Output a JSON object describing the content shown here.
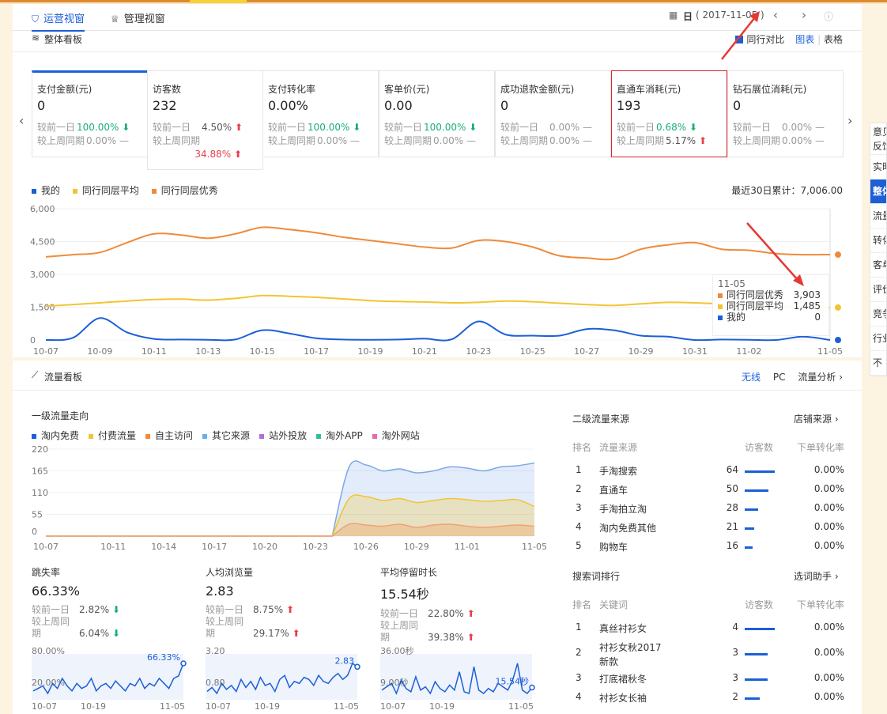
{
  "tabs": [
    {
      "label": "运营视窗"
    },
    {
      "label": "管理视窗"
    }
  ],
  "date": {
    "prefix": "日",
    "value": "( 2017-11-05 )"
  },
  "overview": {
    "title": "整体看板",
    "peer_compare": "同行对比",
    "chart_link": "图表",
    "table_link": "表格",
    "metrics": [
      {
        "label": "支付金额(元)",
        "value": "0",
        "c1_label": "较前一日",
        "c1_val": "100.00%",
        "c1_dir": "down",
        "c2_label": "较上周同期",
        "c2_val": "0.00%",
        "c2_dir": "flat"
      },
      {
        "label": "访客数",
        "value": "232",
        "c1_label": "较前一日",
        "c1_val": "4.50%",
        "c1_dir": "up",
        "c2_label": "较上周同期",
        "c2_val": "34.88%",
        "c2_dir": "up"
      },
      {
        "label": "支付转化率",
        "value": "0.00%",
        "c1_label": "较前一日",
        "c1_val": "100.00%",
        "c1_dir": "down",
        "c2_label": "较上周同期",
        "c2_val": "0.00%",
        "c2_dir": "flat"
      },
      {
        "label": "客单价(元)",
        "value": "0.00",
        "c1_label": "较前一日",
        "c1_val": "100.00%",
        "c1_dir": "down",
        "c2_label": "较上周同期",
        "c2_val": "0.00%",
        "c2_dir": "flat"
      },
      {
        "label": "成功退款金额(元)",
        "value": "0",
        "c1_label": "较前一日",
        "c1_val": "0.00%",
        "c1_dir": "flat",
        "c2_label": "较上周同期",
        "c2_val": "0.00%",
        "c2_dir": "flat"
      },
      {
        "label": "直通车消耗(元)",
        "value": "193",
        "c1_label": "较前一日",
        "c1_val": "0.68%",
        "c1_dir": "down",
        "c2_label": "较上周同期",
        "c2_val": "5.17%",
        "c2_dir": "up"
      },
      {
        "label": "钻石展位消耗(元)",
        "value": "0",
        "c1_label": "较前一日",
        "c1_val": "0.00%",
        "c1_dir": "flat",
        "c2_label": "较上周同期",
        "c2_val": "0.00%",
        "c2_dir": "flat"
      }
    ],
    "cumulative": "最近30日累计：7,006.00",
    "tooltip": {
      "date": "11-05",
      "rows": [
        {
          "name": "同行同层优秀",
          "value": "3,903"
        },
        {
          "name": "同行同层平均",
          "value": "1,485"
        },
        {
          "name": "我的",
          "value": "0"
        }
      ]
    }
  },
  "chart_data": [
    {
      "type": "line",
      "title": "",
      "x": [
        "10-07",
        "10-08",
        "10-09",
        "10-10",
        "10-11",
        "10-12",
        "10-13",
        "10-14",
        "10-15",
        "10-16",
        "10-17",
        "10-18",
        "10-19",
        "10-20",
        "10-21",
        "10-22",
        "10-23",
        "10-24",
        "10-25",
        "10-26",
        "10-27",
        "10-28",
        "10-29",
        "10-30",
        "10-31",
        "11-01",
        "11-02",
        "11-03",
        "11-04",
        "11-05"
      ],
      "x_ticks": [
        "10-07",
        "10-09",
        "10-11",
        "10-13",
        "10-15",
        "10-17",
        "10-19",
        "10-21",
        "10-23",
        "10-25",
        "10-27",
        "10-29",
        "10-31",
        "11-02",
        "11-05"
      ],
      "y_ticks": [
        "6,000",
        "4,500",
        "3,000",
        "1,500",
        "0"
      ],
      "ylim": [
        0,
        6000
      ],
      "colors": {
        "我的": "#1c5fd6",
        "同行同层平均": "#f2c530",
        "同行同层优秀": "#f08a3a"
      },
      "series": [
        {
          "name": "我的",
          "values": [
            0,
            100,
            1000,
            350,
            50,
            20,
            10,
            20,
            450,
            300,
            80,
            20,
            10,
            20,
            60,
            30,
            850,
            250,
            200,
            200,
            500,
            450,
            200,
            150,
            0,
            20,
            10,
            0,
            150,
            0
          ]
        },
        {
          "name": "同行同层平均",
          "values": [
            1550,
            1620,
            1700,
            1780,
            1850,
            1870,
            1820,
            1900,
            2030,
            2000,
            1950,
            1880,
            1800,
            1760,
            1740,
            1700,
            1720,
            1780,
            1750,
            1680,
            1620,
            1580,
            1650,
            1720,
            1700,
            1650,
            1600,
            1520,
            1500,
            1485
          ]
        },
        {
          "name": "同行同层优秀",
          "values": [
            3800,
            3900,
            4000,
            4450,
            4850,
            4800,
            4650,
            4850,
            5150,
            5050,
            4900,
            4700,
            4550,
            4400,
            4250,
            4200,
            4550,
            4500,
            4250,
            3850,
            3750,
            3700,
            4150,
            4350,
            4450,
            4150,
            4100,
            3950,
            3900,
            3903
          ]
        }
      ]
    },
    {
      "type": "area",
      "title": "一级流量走向",
      "x": [
        "10-07",
        "10-08",
        "10-09",
        "10-10",
        "10-11",
        "10-12",
        "10-13",
        "10-14",
        "10-15",
        "10-16",
        "10-17",
        "10-18",
        "10-19",
        "10-20",
        "10-21",
        "10-22",
        "10-23",
        "10-24",
        "10-25",
        "10-26",
        "10-27",
        "10-28",
        "10-29",
        "10-30",
        "10-31",
        "11-01",
        "11-02",
        "11-03",
        "11-04",
        "11-05"
      ],
      "x_ticks": [
        "10-07",
        "10-11",
        "10-14",
        "10-17",
        "10-20",
        "10-23",
        "10-26",
        "10-29",
        "11-01",
        "11-05"
      ],
      "y_ticks": [
        "220",
        "165",
        "110",
        "55",
        "0"
      ],
      "ylim": [
        0,
        220
      ],
      "legend": [
        {
          "name": "淘内免费",
          "color": "#1c5fd6"
        },
        {
          "name": "付费流量",
          "color": "#f2c530"
        },
        {
          "name": "自主访问",
          "color": "#f08a3a"
        },
        {
          "name": "其它来源",
          "color": "#6aaee6"
        },
        {
          "name": "站外投放",
          "color": "#b36be0"
        },
        {
          "name": "淘外APP",
          "color": "#2bbf9c"
        },
        {
          "name": "淘外网站",
          "color": "#e66aa8"
        }
      ],
      "series": [
        {
          "name": "淘内免费",
          "values": [
            0,
            0,
            0,
            0,
            0,
            0,
            0,
            0,
            0,
            0,
            0,
            0,
            0,
            0,
            0,
            0,
            0,
            0,
            175,
            180,
            165,
            170,
            160,
            165,
            175,
            172,
            165,
            175,
            178,
            185
          ]
        },
        {
          "name": "付费流量",
          "values": [
            0,
            0,
            0,
            0,
            0,
            0,
            0,
            0,
            0,
            0,
            0,
            0,
            0,
            0,
            0,
            0,
            0,
            0,
            95,
            100,
            90,
            95,
            85,
            90,
            95,
            92,
            88,
            90,
            92,
            75
          ]
        },
        {
          "name": "自主访问",
          "values": [
            0,
            0,
            0,
            0,
            0,
            0,
            0,
            0,
            0,
            0,
            0,
            0,
            0,
            0,
            0,
            0,
            0,
            0,
            30,
            28,
            25,
            30,
            22,
            28,
            30,
            25,
            22,
            25,
            28,
            25
          ]
        }
      ]
    }
  ],
  "flow": {
    "title": "流量看板",
    "wireless": "无线",
    "pc": "PC",
    "analysis": "流量分析",
    "kpis": [
      {
        "title": "跳失率",
        "value": "66.33%",
        "c1_label": "较前一日",
        "c1_val": "2.82%",
        "c1_dir": "down",
        "c2_label1": "较上周同",
        "c2_label2": "期",
        "c2_val": "6.04%",
        "c2_dir": "down",
        "spark_top": "80.00%",
        "spark_bottom": "20.00%",
        "spark_end": "66.33%",
        "ticks": [
          "10-07",
          "10-19",
          "11-05"
        ],
        "spark": [
          55,
          56,
          57,
          54,
          58,
          56,
          60,
          57,
          55,
          58,
          56,
          57,
          60,
          55,
          57,
          58,
          56,
          59,
          57,
          55,
          58,
          57,
          60,
          56,
          58,
          57,
          60,
          58,
          56,
          60,
          61,
          66
        ]
      },
      {
        "title": "人均浏览量",
        "value": "2.83",
        "c1_label": "较前一日",
        "c1_val": "8.75%",
        "c1_dir": "up",
        "c2_label1": "较上周同",
        "c2_label2": "期",
        "c2_val": "29.17%",
        "c2_dir": "up",
        "spark_top": "3.20",
        "spark_bottom": "0.80",
        "spark_end": "2.83",
        "ticks": [
          "10-07",
          "10-19",
          "11-05"
        ],
        "spark": [
          1.6,
          1.8,
          1.5,
          2.0,
          1.7,
          1.9,
          1.6,
          2.2,
          1.8,
          2.1,
          1.7,
          2.3,
          1.9,
          2.0,
          1.6,
          2.2,
          2.4,
          1.8,
          2.1,
          2.0,
          2.3,
          2.2,
          1.9,
          2.4,
          2.1,
          2.0,
          2.3,
          2.5,
          2.2,
          2.4,
          3.0,
          2.83
        ]
      },
      {
        "title": "平均停留时长",
        "value": "15.54秒",
        "c1_label": "较前一日",
        "c1_val": "22.80%",
        "c1_dir": "up",
        "c2_label1": "较上周同",
        "c2_label2": "期",
        "c2_val": "39.38%",
        "c2_dir": "up",
        "spark_top": "36.00秒",
        "spark_bottom": "9.00秒",
        "spark_end": "15.54秒",
        "ticks": [
          "10-07",
          "10-19",
          "11-05"
        ],
        "spark": [
          14,
          16,
          18,
          12,
          20,
          15,
          13,
          22,
          14,
          16,
          12,
          19,
          15,
          13,
          17,
          14,
          25,
          13,
          12,
          28,
          14,
          12,
          15,
          13,
          18,
          16,
          14,
          20,
          30,
          14,
          12,
          15.54
        ]
      }
    ],
    "level2": {
      "title": "二级流量来源",
      "link": "店铺来源",
      "headers": [
        "排名",
        "流量来源",
        "访客数",
        "下单转化率"
      ],
      "rows": [
        {
          "rank": "1",
          "name": "手淘搜索",
          "visitors": "64",
          "bar": 64,
          "rate": "0.00%"
        },
        {
          "rank": "2",
          "name": "直通车",
          "visitors": "50",
          "bar": 50,
          "rate": "0.00%"
        },
        {
          "rank": "3",
          "name": "手淘拍立淘",
          "visitors": "28",
          "bar": 28,
          "rate": "0.00%"
        },
        {
          "rank": "4",
          "name": "淘内免费其他",
          "visitors": "21",
          "bar": 21,
          "rate": "0.00%"
        },
        {
          "rank": "5",
          "name": "购物车",
          "visitors": "16",
          "bar": 16,
          "rate": "0.00%"
        }
      ]
    },
    "search": {
      "title": "搜索词排行",
      "link": "选词助手",
      "headers": [
        "排名",
        "关键词",
        "访客数",
        "下单转化率"
      ],
      "rows": [
        {
          "rank": "1",
          "name": "真丝衬衫女",
          "visitors": "4",
          "bar": 4,
          "rate": "0.00%"
        },
        {
          "rank": "2",
          "name": "衬衫女秋2017",
          "name2": "新款",
          "visitors": "3",
          "bar": 3,
          "rate": "0.00%"
        },
        {
          "rank": "3",
          "name": "打底裙秋冬",
          "visitors": "3",
          "bar": 3,
          "rate": "0.00%"
        },
        {
          "rank": "4",
          "name": "衬衫女长袖",
          "visitors": "2",
          "bar": 2,
          "rate": "0.00%"
        }
      ]
    }
  },
  "sidebar": {
    "items": [
      {
        "label": "意见"
      },
      {
        "label": "反馈"
      },
      {
        "label": "实时"
      },
      {
        "label": "整体"
      },
      {
        "label": "流量"
      },
      {
        "label": "转化"
      },
      {
        "label": "客单"
      },
      {
        "label": "评价"
      },
      {
        "label": "竞争"
      },
      {
        "label": "行业"
      },
      {
        "label": "不"
      }
    ]
  }
}
